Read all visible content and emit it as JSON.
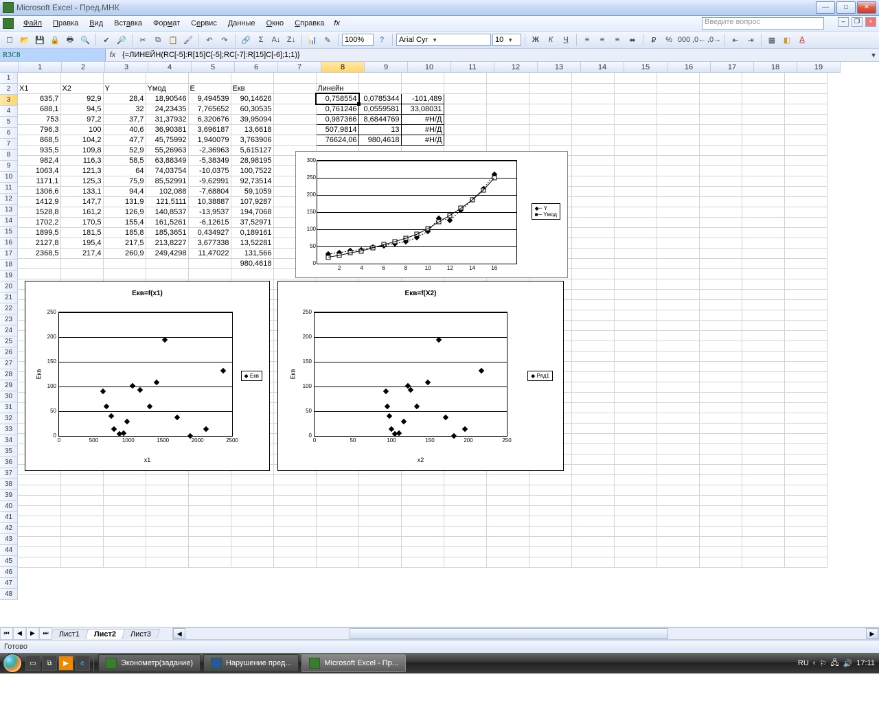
{
  "titlebar": {
    "text": "Microsoft Excel - Пред.МНК"
  },
  "menu": {
    "items": [
      "Файл",
      "Правка",
      "Вид",
      "Вставка",
      "Формат",
      "Сервис",
      "Данные",
      "Окно",
      "Справка"
    ],
    "question_placeholder": "Введите вопрос"
  },
  "toolbar": {
    "font": "Arial Cyr",
    "size": "10"
  },
  "formula": {
    "namebox": "R3C8",
    "content": "{=ЛИНЕЙН(RC[-5]:R[15]C[-5];RC[-7]:R[15]C[-6];1;1)}"
  },
  "columns": [
    "1",
    "2",
    "3",
    "4",
    "5",
    "6",
    "7",
    "8",
    "9",
    "10",
    "11",
    "12",
    "13",
    "14",
    "15",
    "16",
    "17",
    "18",
    "19"
  ],
  "active_col_index": 7,
  "rows_count": 48,
  "active_row_index": 2,
  "headers": [
    "X1",
    "X2",
    "Y",
    "Yмод",
    "E",
    "Eкв"
  ],
  "linest_header": "Линейн",
  "table": [
    [
      "635,7",
      "92,9",
      "28,4",
      "18,90546",
      "9,494539",
      "90,14626"
    ],
    [
      "688,1",
      "94,5",
      "32",
      "24,23435",
      "7,765652",
      "60,30535"
    ],
    [
      "753",
      "97,2",
      "37,7",
      "31,37932",
      "6,320676",
      "39,95094"
    ],
    [
      "796,3",
      "100",
      "40,6",
      "36,90381",
      "3,696187",
      "13,6618"
    ],
    [
      "868,5",
      "104,2",
      "47,7",
      "45,75992",
      "1,940079",
      "3,763906"
    ],
    [
      "935,5",
      "109,8",
      "52,9",
      "55,26963",
      "-2,36963",
      "5,615127"
    ],
    [
      "982,4",
      "116,3",
      "58,5",
      "63,88349",
      "-5,38349",
      "28,98195"
    ],
    [
      "1063,4",
      "121,3",
      "64",
      "74,03754",
      "-10,0375",
      "100,7522"
    ],
    [
      "1171,1",
      "125,3",
      "75,9",
      "85,52991",
      "-9,62991",
      "92,73514"
    ],
    [
      "1306,6",
      "133,1",
      "94,4",
      "102,088",
      "-7,68804",
      "59,1059"
    ],
    [
      "1412,9",
      "147,7",
      "131,9",
      "121,5111",
      "10,38887",
      "107,9287"
    ],
    [
      "1528,8",
      "161,2",
      "126,9",
      "140,8537",
      "-13,9537",
      "194,7068"
    ],
    [
      "1702,2",
      "170,5",
      "155,4",
      "161,5261",
      "-6,12615",
      "37,52971"
    ],
    [
      "1899,5",
      "181,5",
      "185,8",
      "185,3651",
      "0,434927",
      "0,189161"
    ],
    [
      "2127,8",
      "195,4",
      "217,5",
      "213,8227",
      "3,677338",
      "13,52281"
    ],
    [
      "2368,5",
      "217,4",
      "260,9",
      "249,4298",
      "11,47022",
      "131,566"
    ]
  ],
  "sum_ekv": "980,4618",
  "linest": [
    [
      "0,758554",
      "0,0785344",
      "-101,489"
    ],
    [
      "0,761246",
      "0,0559581",
      "33,08031"
    ],
    [
      "0,987366",
      "8,6844769",
      "#Н/Д"
    ],
    [
      "507,9814",
      "13",
      "#Н/Д"
    ],
    [
      "76624,06",
      "980,4618",
      "#Н/Д"
    ]
  ],
  "chart_data": [
    {
      "type": "line",
      "title": "",
      "x": [
        1,
        2,
        3,
        4,
        5,
        6,
        7,
        8,
        9,
        10,
        11,
        12,
        13,
        14,
        15,
        16
      ],
      "series": [
        {
          "name": "Y",
          "values": [
            28.4,
            32,
            37.7,
            40.6,
            47.7,
            52.9,
            58.5,
            64,
            75.9,
            94.4,
            131.9,
            126.9,
            155.4,
            185.8,
            217.5,
            260.9
          ]
        },
        {
          "name": "Yмод",
          "values": [
            18.9,
            24.2,
            31.4,
            36.9,
            45.8,
            55.3,
            63.9,
            74.0,
            85.5,
            102.1,
            121.5,
            140.9,
            161.5,
            185.4,
            213.8,
            249.4
          ]
        }
      ],
      "xlim": [
        0,
        18
      ],
      "ylim": [
        0,
        300
      ],
      "yticks": [
        0,
        50,
        100,
        150,
        200,
        250,
        300
      ],
      "legend": [
        "Y",
        "Yмод"
      ]
    },
    {
      "type": "scatter",
      "title": "Екв=f(x1)",
      "xlabel": "x1",
      "ylabel": "Екв",
      "legend": [
        "Екв"
      ],
      "xlim": [
        0,
        2500
      ],
      "ylim": [
        0,
        250
      ],
      "xticks": [
        0,
        500,
        1000,
        1500,
        2000,
        2500
      ],
      "yticks": [
        0,
        50,
        100,
        150,
        200,
        250
      ],
      "x": [
        635.7,
        688.1,
        753,
        796.3,
        868.5,
        935.5,
        982.4,
        1063.4,
        1171.1,
        1306.6,
        1412.9,
        1528.8,
        1702.2,
        1899.5,
        2127.8,
        2368.5
      ],
      "y": [
        90.1,
        60.3,
        40.0,
        13.7,
        3.8,
        5.6,
        29.0,
        100.8,
        92.7,
        59.1,
        107.9,
        194.7,
        37.5,
        0.19,
        13.5,
        131.6
      ]
    },
    {
      "type": "scatter",
      "title": "Екв=f(X2)",
      "xlabel": "x2",
      "ylabel": "Екв",
      "legend": [
        "Ряд1"
      ],
      "xlim": [
        0,
        250
      ],
      "ylim": [
        0,
        250
      ],
      "xticks": [
        0,
        50,
        100,
        150,
        200,
        250
      ],
      "yticks": [
        0,
        50,
        100,
        150,
        200,
        250
      ],
      "x": [
        92.9,
        94.5,
        97.2,
        100,
        104.2,
        109.8,
        116.3,
        121.3,
        125.3,
        133.1,
        147.7,
        161.2,
        170.5,
        181.5,
        195.4,
        217.4
      ],
      "y": [
        90.1,
        60.3,
        40.0,
        13.7,
        3.8,
        5.6,
        29.0,
        100.8,
        92.7,
        59.1,
        107.9,
        194.7,
        37.5,
        0.19,
        13.5,
        131.6
      ]
    }
  ],
  "sheets": {
    "tabs": [
      "Лист1",
      "Лист2",
      "Лист3"
    ],
    "active": 1
  },
  "status": "Готово",
  "taskbar": {
    "tasks": [
      "Эконометр(задание)",
      "Нарушение пред...",
      "Microsoft Excel - Пр..."
    ],
    "active": 2,
    "lang": "RU",
    "time": "17:11"
  }
}
